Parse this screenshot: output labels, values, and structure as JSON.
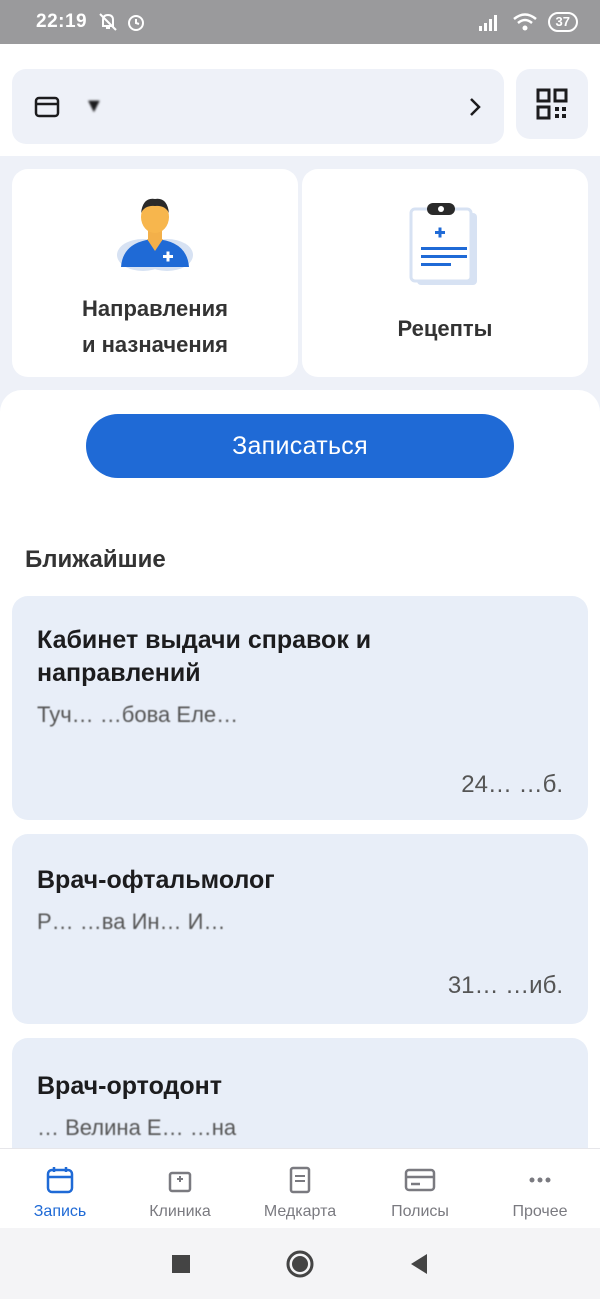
{
  "status_bar": {
    "time": "22:19",
    "battery": "37"
  },
  "profile": {
    "name": "▼"
  },
  "tiles": [
    {
      "label_line1": "Направления",
      "label_line2": "и назначения"
    },
    {
      "label": "Рецепты"
    }
  ],
  "main": {
    "book_button": "Записаться",
    "section_title": "Ближайшие",
    "appointments": [
      {
        "title_line1": "Кабинет выдачи справок и",
        "title_line2": "направлений",
        "doctor": "Туч… …бова Еле…",
        "date": "",
        "price": "24… …б."
      },
      {
        "title_line1": "Врач-офтальмолог",
        "doctor": "Р… …ва Ин… И…",
        "date": "",
        "price": "31… …иб."
      },
      {
        "title_line1": "Врач-ортодонт",
        "doctor": "… Велина Е… …на"
      }
    ]
  },
  "bottom_nav": [
    {
      "label": "Запись",
      "active": true
    },
    {
      "label": "Клиника",
      "active": false
    },
    {
      "label": "Медкарта",
      "active": false
    },
    {
      "label": "Полисы",
      "active": false
    },
    {
      "label": "Прочее",
      "active": false
    }
  ],
  "colors": {
    "accent": "#1f6ad6",
    "card_bg": "#e8eef8",
    "status_bar": "#9a9a9c"
  }
}
